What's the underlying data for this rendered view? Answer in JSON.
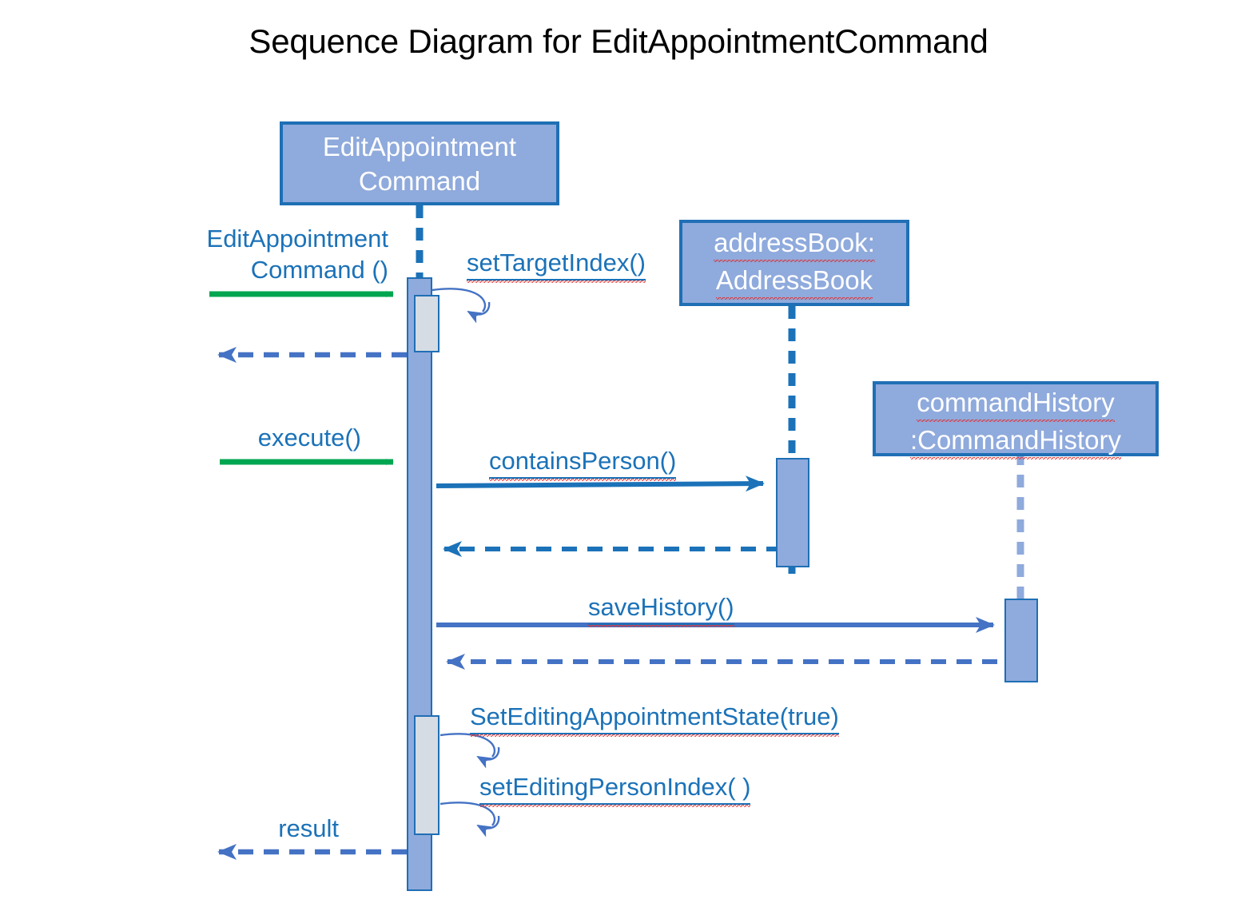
{
  "title": "Sequence Diagram for EditAppointmentCommand",
  "colors": {
    "participant_fill": "#8FAADC",
    "participant_border": "#1F6FB5",
    "activation_fill": "#8FAADC",
    "nested_activation_fill": "#D6DCE4",
    "call_arrow": "#1B72B8",
    "medium_arrow": "#4472C4",
    "return_arrow": "#4472C4",
    "actor_call_arrow": "#00A650",
    "label_text": "#1B72B8",
    "title_text": "#000000",
    "spellcheck_underline": "#E03030",
    "background": "#FFFFFF"
  },
  "participants": [
    {
      "id": "edit-command",
      "lines": [
        "EditAppointment",
        "Command"
      ],
      "display": ":EditAppointment Command",
      "prefix": ":",
      "spellcheck": false
    },
    {
      "id": "address-book",
      "lines": [
        "addressBook:",
        "AddressBook"
      ],
      "display": "addressBook: AddressBook",
      "spellcheck": true
    },
    {
      "id": "command-history",
      "lines": [
        "commandHistory",
        ":CommandHistory"
      ],
      "display": "commandHistory :CommandHistory",
      "spellcheck": true
    }
  ],
  "messages": [
    {
      "id": "edit-appointment-command",
      "label_lines": [
        "EditAppointment",
        "Command ()"
      ],
      "label": "EditAppointment Command ()",
      "kind": "found-call",
      "style": "solid",
      "color": "#00A650",
      "direction": "right",
      "from": "boundary",
      "to": "edit-command"
    },
    {
      "id": "set-target-index",
      "label": "setTargetIndex()",
      "kind": "self-call",
      "style": "solid",
      "color": "#4472C4",
      "direction": "self",
      "from": "edit-command",
      "to": "edit-command"
    },
    {
      "id": "return-constructor",
      "label": "",
      "kind": "return",
      "style": "dashed",
      "color": "#4472C4",
      "direction": "left",
      "from": "edit-command",
      "to": "boundary"
    },
    {
      "id": "execute",
      "label": "execute()",
      "kind": "found-call",
      "style": "solid",
      "color": "#00A650",
      "direction": "right",
      "from": "boundary",
      "to": "edit-command"
    },
    {
      "id": "contains-person",
      "label": "containsPerson()",
      "kind": "call",
      "style": "solid",
      "color": "#1B72B8",
      "direction": "right",
      "from": "edit-command",
      "to": "address-book"
    },
    {
      "id": "return-contains-person",
      "label": "",
      "kind": "return",
      "style": "dashed",
      "color": "#1B72B8",
      "direction": "left",
      "from": "address-book",
      "to": "edit-command"
    },
    {
      "id": "save-history",
      "label": "saveHistory()",
      "kind": "call",
      "style": "solid",
      "color": "#4472C4",
      "direction": "right",
      "from": "edit-command",
      "to": "command-history"
    },
    {
      "id": "return-save-history",
      "label": "",
      "kind": "return",
      "style": "dashed",
      "color": "#4472C4",
      "direction": "left",
      "from": "command-history",
      "to": "edit-command"
    },
    {
      "id": "set-editing-appointment-state",
      "label": "SetEditingAppointmentState(true)",
      "kind": "self-call",
      "style": "solid",
      "color": "#4472C4",
      "direction": "self",
      "from": "edit-command",
      "to": "edit-command"
    },
    {
      "id": "set-editing-person-index",
      "label": "setEditingPersonIndex( )",
      "kind": "self-call",
      "style": "solid",
      "color": "#4472C4",
      "direction": "self",
      "from": "edit-command",
      "to": "edit-command"
    },
    {
      "id": "result",
      "label": "result",
      "kind": "return",
      "style": "dashed",
      "color": "#4472C4",
      "direction": "left",
      "from": "edit-command",
      "to": "boundary"
    }
  ]
}
